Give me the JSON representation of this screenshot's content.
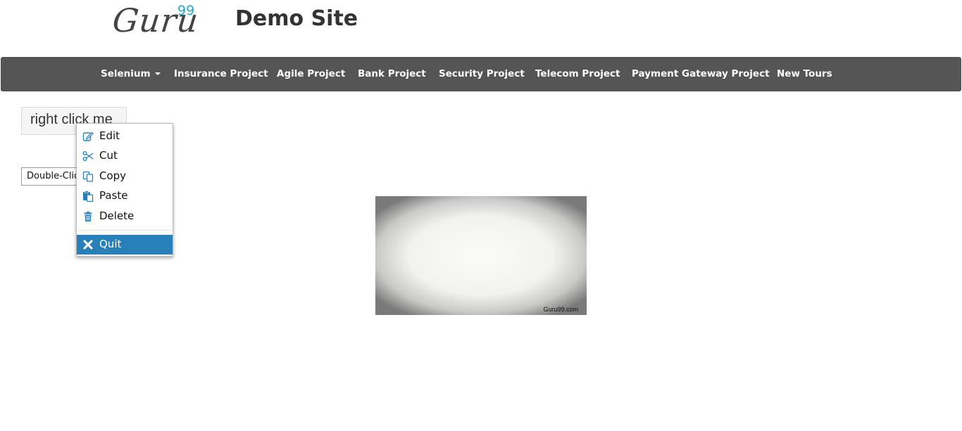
{
  "header": {
    "logo_text": "Guru",
    "logo_sup": "99",
    "site_title": "Demo Site"
  },
  "nav": {
    "items": [
      {
        "label": "Selenium",
        "has_dropdown": true
      },
      {
        "label": "Insurance Project"
      },
      {
        "label": "Agile Project"
      },
      {
        "label": "Bank Project"
      },
      {
        "label": "Security Project"
      },
      {
        "label": "Telecom Project"
      },
      {
        "label": "Payment Gateway Project"
      },
      {
        "label": "New Tours"
      }
    ]
  },
  "main": {
    "right_click_label": "right click me",
    "double_click_label": "Double-Click Me To See Alert"
  },
  "context_menu": {
    "items": [
      {
        "label": "Edit",
        "icon": "edit-icon"
      },
      {
        "label": "Cut",
        "icon": "scissors-icon"
      },
      {
        "label": "Copy",
        "icon": "copy-icon"
      },
      {
        "label": "Paste",
        "icon": "paste-icon"
      },
      {
        "label": "Delete",
        "icon": "trash-icon"
      },
      {
        "label": "Quit",
        "icon": "close-icon",
        "highlighted": true
      }
    ]
  },
  "image": {
    "caption": "Guru99.com"
  },
  "colors": {
    "nav_bg": "#555555",
    "accent": "#2aa6c7",
    "menu_icon": "#2980b9",
    "menu_highlight": "#2980b9"
  }
}
